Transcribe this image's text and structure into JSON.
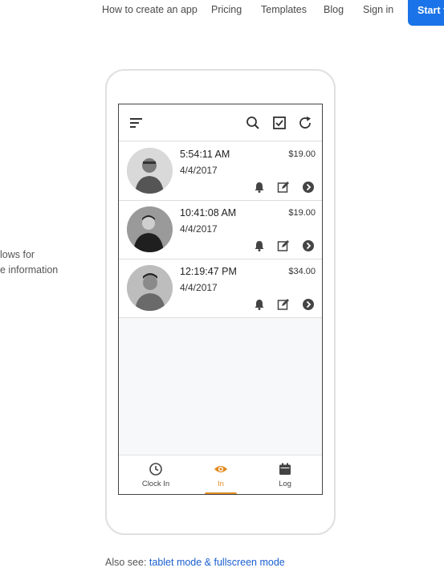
{
  "nav": {
    "links": [
      "How to create an app",
      "Pricing",
      "Templates",
      "Blog",
      "Sign in"
    ],
    "cta_label": "Start f"
  },
  "side_text": [
    "lows for",
    "e information"
  ],
  "app": {
    "toolbar_icons": [
      "menu-icon",
      "search-icon",
      "checkbox-icon",
      "refresh-icon"
    ],
    "rows": [
      {
        "time": "5:54:11 AM",
        "date": "4/4/2017",
        "amount": "$19.00"
      },
      {
        "time": "10:41:08 AM",
        "date": "4/4/2017",
        "amount": "$19.00"
      },
      {
        "time": "12:19:47 PM",
        "date": "4/4/2017",
        "amount": "$34.00"
      }
    ],
    "row_icons": [
      "bell-icon",
      "edit-icon",
      "chevron-right-circle-icon"
    ],
    "tabs": [
      {
        "label": "Clock In",
        "icon": "clock-icon"
      },
      {
        "label": "In",
        "icon": "eye-icon"
      },
      {
        "label": "Log",
        "icon": "calendar-icon"
      }
    ],
    "active_tab": "In",
    "accent_color": "#e08a1e"
  },
  "footer": {
    "prefix": "Also see: ",
    "link": "tablet mode & fullscreen mode"
  },
  "colors": {
    "cta": "#1a73e8",
    "link": "#1a5fd0"
  }
}
